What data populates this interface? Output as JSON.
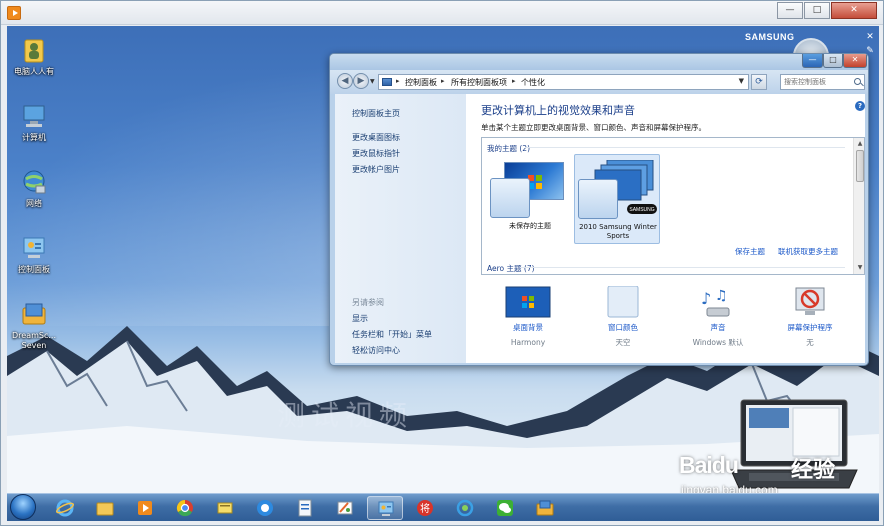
{
  "outer_window": {
    "minimize": "—",
    "maximize": "□",
    "close": "✕"
  },
  "desktop": {
    "icons": [
      {
        "label": "电脑人人有",
        "icon": "user-folder-icon"
      },
      {
        "label": "计算机",
        "icon": "computer-icon"
      },
      {
        "label": "网络",
        "icon": "network-icon"
      },
      {
        "label": "控制面板",
        "icon": "control-panel-icon"
      },
      {
        "label": "DreamSc... Seven",
        "icon": "dreamscene-icon"
      }
    ],
    "watermark_text": "测试视频",
    "samsung_text": "SAMSUNG",
    "side_close": "✕",
    "side_tools": "✎"
  },
  "cp_window": {
    "title_buttons": {
      "minimize": "—",
      "maximize": "□",
      "close": "✕"
    },
    "breadcrumbs": [
      "控制面板",
      "所有控制面板项",
      "个性化"
    ],
    "search_placeholder": "搜索控制面板",
    "sidebar": {
      "home": "控制面板主页",
      "links": [
        "更改桌面图标",
        "更改鼠标指针",
        "更改帐户图片"
      ],
      "see_also_header": "另请参阅",
      "see_also": [
        "显示",
        "任务栏和「开始」菜单",
        "轻松访问中心"
      ]
    },
    "main": {
      "heading": "更改计算机上的视觉效果和声音",
      "description": "单击某个主题立即更改桌面背景、窗口颜色、声音和屏幕保护程序。",
      "my_themes_label": "我的主题 (2)",
      "themes": [
        {
          "label": "未保存的主题"
        },
        {
          "label": "2010 Samsung Winter Sports"
        }
      ],
      "samsung_mark": "SAMSUNG",
      "save_theme": "保存主题",
      "get_more_themes": "联机获取更多主题",
      "aero_label": "Aero 主题 (7)",
      "options": [
        {
          "link": "桌面背景",
          "sub": "Harmony",
          "icon": "desktop-background-icon"
        },
        {
          "link": "窗口颜色",
          "sub": "天空",
          "icon": "window-color-icon"
        },
        {
          "link": "声音",
          "sub": "Windows 默认",
          "icon": "sound-icon"
        },
        {
          "link": "屏幕保护程序",
          "sub": "无",
          "icon": "screensaver-icon"
        }
      ]
    }
  },
  "overlay": {
    "baidu_logo": "Baidu",
    "baidu_cn": "经验",
    "baidu_url": "jingyan.baidu.com"
  },
  "taskbar": {
    "items": [
      {
        "icon": "start-orb-icon",
        "active": false
      },
      {
        "icon": "internet-explorer-icon",
        "active": false
      },
      {
        "icon": "explorer-folder-icon",
        "active": false
      },
      {
        "icon": "media-player-icon",
        "active": false
      },
      {
        "icon": "chrome-icon",
        "active": false
      },
      {
        "icon": "notes-icon",
        "active": false
      },
      {
        "icon": "browser-icon",
        "active": false
      },
      {
        "icon": "document-icon",
        "active": false
      },
      {
        "icon": "paint-icon",
        "active": false
      },
      {
        "icon": "control-panel-icon",
        "active": true
      },
      {
        "icon": "chess-icon",
        "active": false
      },
      {
        "icon": "sync-icon",
        "active": false
      },
      {
        "icon": "wechat-icon",
        "active": false
      },
      {
        "icon": "folder-app-icon",
        "active": false
      }
    ]
  }
}
